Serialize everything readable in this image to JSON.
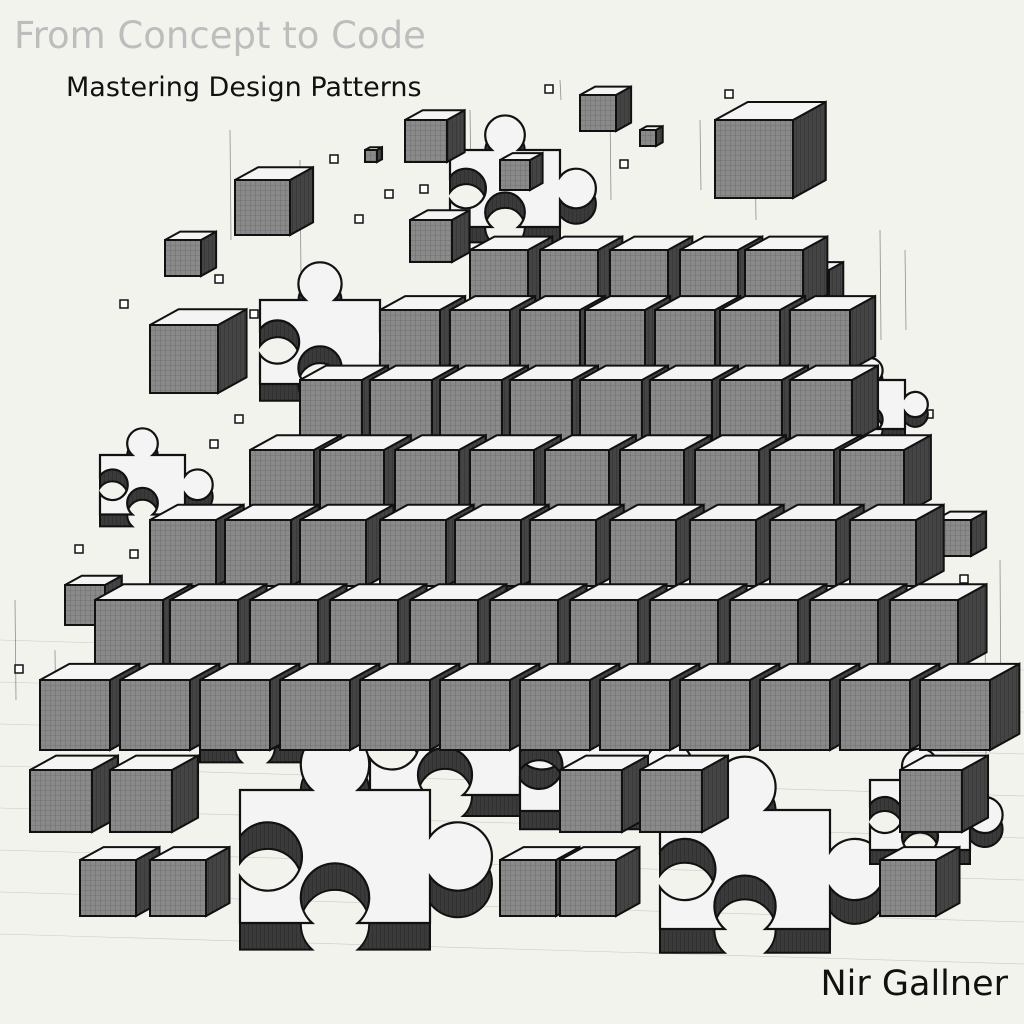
{
  "cover": {
    "title": "From Concept to Code",
    "subtitle": "Mastering Design Patterns",
    "author": "Nir Gallner"
  },
  "illustration": {
    "subject": "hand-drawn pile of cubes and puzzle pieces",
    "colors": {
      "background": "#f3f3ee",
      "ink": "#111111",
      "top_face": "#f4f4f4",
      "left_face": "#8a8a8a",
      "right_face": "#444444",
      "title_gray": "#bdbdbd"
    }
  }
}
